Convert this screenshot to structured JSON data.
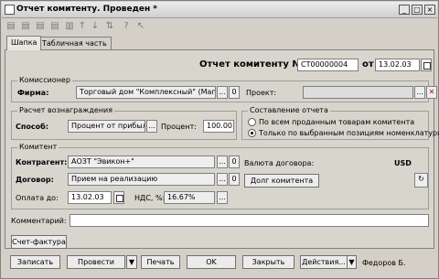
{
  "window": {
    "title": "Отчет комитенту. Проведен *"
  },
  "toolbar": {
    "icons": [
      "row-add-icon",
      "row-copy-icon",
      "row-edit-icon",
      "row-delete-icon",
      "arrow-up-icon",
      "arrow-down-icon",
      "sort-icon",
      "help-icon",
      "pointer-icon"
    ]
  },
  "tabs": [
    "Шапка",
    "Табличная часть"
  ],
  "header": {
    "doc_label": "Отчет комитенту №",
    "number": "СТ00000004",
    "date_from_label": "от",
    "date": "13.02.03"
  },
  "commissioner": {
    "group_title": "Комиссионер",
    "firm_label": "Фирма:",
    "firm_value": "Торговый дом \"Комплексный\" (Магаз",
    "firm_btn": "...",
    "firm_zero": "0",
    "project_label": "Проект:",
    "project_btn": "...",
    "project_clear": "✕"
  },
  "reward": {
    "group_title": "Расчет вознаграждения",
    "method_label": "Способ:",
    "method_value": "Процент от прибыли",
    "method_btn": "...",
    "percent_label": "Процент:",
    "percent_value": "100.00"
  },
  "report": {
    "group_title": "Составление отчета",
    "option_all": "По всем проданным товарам комитента",
    "option_selected": "Только по выбранным позициям номенклатуры"
  },
  "consignor": {
    "group_title": "Комитент",
    "contractor_label": "Контрагент:",
    "contractor_value": "АОЗТ \"Эвикон+\"",
    "contractor_btn": "...",
    "contractor_zero": "0",
    "contract_label": "Договор:",
    "contract_value": "Прием на реализацию",
    "contract_btn": "...",
    "contract_zero": "0",
    "payment_label": "Оплата до:",
    "payment_date": "13.02.03",
    "vat_label": "НДС, %:",
    "vat_value": "16.67%",
    "vat_btn": "...",
    "currency_label": "Валюта договора:",
    "currency_value": "USD",
    "debt_button": "Долг комитента"
  },
  "comment": {
    "label": "Комментарий:",
    "value": ""
  },
  "invoice_button": "Счет-фактура",
  "footer": {
    "write": "Записать",
    "post": "Провести",
    "post_arrow": "▼",
    "print": "Печать",
    "ok": "OK",
    "close": "Закрыть",
    "actions": "Действия...",
    "actions_arrow": "▼",
    "user": "Федоров Б."
  }
}
